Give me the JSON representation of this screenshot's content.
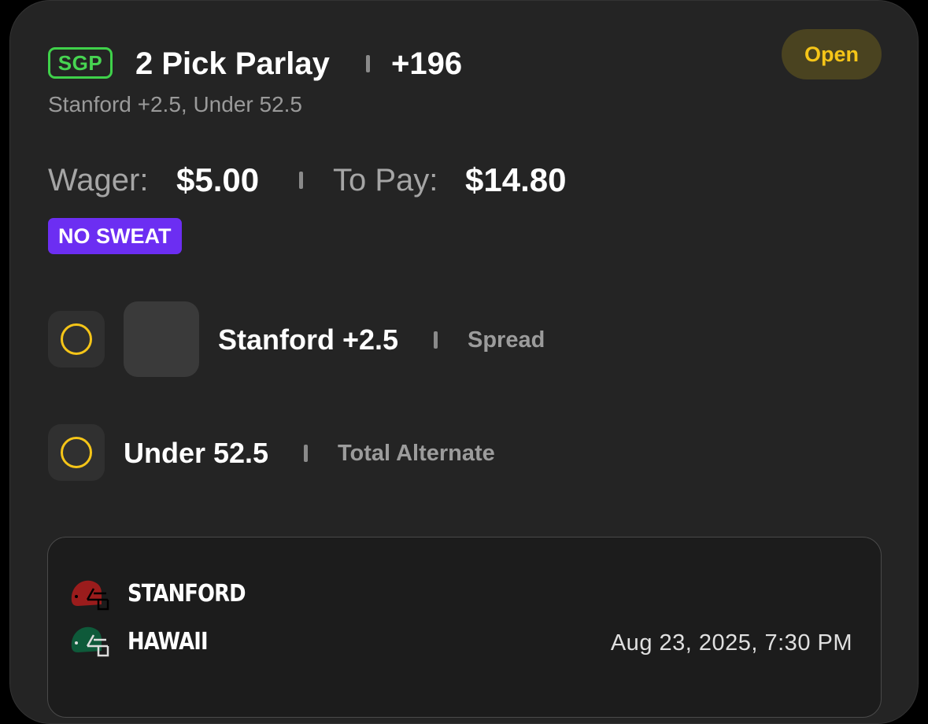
{
  "bet": {
    "badge": "SGP",
    "title": "2 Pick Parlay",
    "odds": "+196",
    "subtitle": "Stanford +2.5, Under 52.5",
    "status": "Open"
  },
  "wager": {
    "wager_label": "Wager:",
    "wager_value": "$5.00",
    "pay_label": "To Pay:",
    "pay_value": "$14.80"
  },
  "promo": {
    "label": "NO SWEAT"
  },
  "picks": [
    {
      "label": "Stanford +2.5",
      "market": "Spread"
    },
    {
      "label": "Under 52.5",
      "market": "Total Alternate"
    }
  ],
  "game": {
    "teams": [
      {
        "name": "STANFORD",
        "helmet_color": "#9b1c1c"
      },
      {
        "name": "HAWAII",
        "helmet_color": "#0e5a3a"
      }
    ],
    "datetime": "Aug 23, 2025, 7:30 PM"
  },
  "colors": {
    "accent_green": "#47d451",
    "status_yellow": "#f5c518",
    "promo_purple": "#6c2ef2",
    "background": "#242424"
  }
}
